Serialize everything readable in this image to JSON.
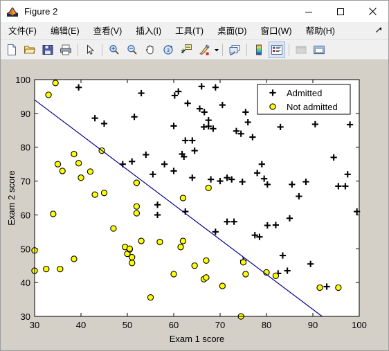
{
  "window": {
    "title": "Figure 2",
    "icon": "matlab-membrane-icon",
    "controls": {
      "minimize": "minimize-icon",
      "maximize": "maximize-icon",
      "close": "close-icon"
    }
  },
  "menubar": {
    "items": [
      {
        "name": "file",
        "text": "文件(F)",
        "label": "文件",
        "accel": "F"
      },
      {
        "name": "edit",
        "text": "编辑(E)",
        "label": "编辑",
        "accel": "E"
      },
      {
        "name": "view",
        "text": "查看(V)",
        "label": "查看",
        "accel": "V"
      },
      {
        "name": "insert",
        "text": "插入(I)",
        "label": "插入",
        "accel": "I"
      },
      {
        "name": "tools",
        "text": "工具(T)",
        "label": "工具",
        "accel": "T"
      },
      {
        "name": "desktop",
        "text": "桌面(D)",
        "label": "桌面",
        "accel": "D"
      },
      {
        "name": "window",
        "text": "窗口(W)",
        "label": "窗口",
        "accel": "W"
      },
      {
        "name": "help",
        "text": "帮助(H)",
        "label": "帮助",
        "accel": "H"
      }
    ],
    "dock_control": "undock-arrow-icon"
  },
  "toolbar": {
    "buttons": [
      {
        "name": "new-figure-button",
        "icon": "new-document-icon",
        "state": "enabled"
      },
      {
        "name": "open-file-button",
        "icon": "open-folder-icon",
        "state": "enabled"
      },
      {
        "name": "save-figure-button",
        "icon": "save-disk-icon",
        "state": "enabled"
      },
      {
        "name": "print-figure-button",
        "icon": "printer-icon",
        "state": "enabled"
      },
      {
        "name": "separator",
        "icon": "separator",
        "state": "n/a"
      },
      {
        "name": "edit-plot-button",
        "icon": "cursor-arrow-icon",
        "state": "enabled"
      },
      {
        "name": "separator",
        "icon": "separator",
        "state": "n/a"
      },
      {
        "name": "zoom-in-button",
        "icon": "zoom-in-icon",
        "state": "enabled"
      },
      {
        "name": "zoom-out-button",
        "icon": "zoom-out-icon",
        "state": "enabled"
      },
      {
        "name": "pan-button",
        "icon": "hand-pan-icon",
        "state": "enabled"
      },
      {
        "name": "rotate-3d-button",
        "icon": "rotate-3d-icon",
        "state": "enabled"
      },
      {
        "name": "data-cursor-button",
        "icon": "data-cursor-icon",
        "state": "enabled"
      },
      {
        "name": "brush-button",
        "icon": "brush-icon",
        "state": "enabled"
      },
      {
        "name": "brush-dropdown",
        "icon": "caret-down-icon",
        "state": "enabled"
      },
      {
        "name": "separator",
        "icon": "separator",
        "state": "n/a"
      },
      {
        "name": "link-plot-button",
        "icon": "link-plot-icon",
        "state": "enabled"
      },
      {
        "name": "separator",
        "icon": "separator",
        "state": "n/a"
      },
      {
        "name": "colorbar-button",
        "icon": "colorbar-icon",
        "state": "enabled"
      },
      {
        "name": "legend-button",
        "icon": "legend-icon",
        "state": "active"
      },
      {
        "name": "separator",
        "icon": "separator",
        "state": "n/a"
      },
      {
        "name": "hide-plot-tools-button",
        "icon": "hide-plot-tools-icon",
        "state": "disabled"
      },
      {
        "name": "show-plot-tools-button",
        "icon": "show-plot-tools-icon",
        "state": "enabled"
      }
    ]
  },
  "chart_data": {
    "type": "scatter",
    "title": "",
    "xlabel": "Exam 1 score",
    "ylabel": "Exam 2 score",
    "xlim": [
      30,
      100
    ],
    "ylim": [
      30,
      100
    ],
    "xticks": [
      30,
      40,
      50,
      60,
      70,
      80,
      90,
      100
    ],
    "yticks": [
      30,
      40,
      50,
      60,
      70,
      80,
      90,
      100
    ],
    "grid": false,
    "background": "#ffffff",
    "legend": {
      "position": "top-right",
      "entries": [
        {
          "label": "Admitted",
          "marker": "plus",
          "color": "#000000",
          "edge": "#000000"
        },
        {
          "label": "Not admitted",
          "marker": "circle",
          "color": "#ffff00",
          "edge": "#000000"
        }
      ]
    },
    "series": [
      {
        "name": "Admitted",
        "marker": "plus",
        "color": "#000000",
        "points": [
          [
            39.5,
            97.7
          ],
          [
            45.0,
            87.0
          ],
          [
            43.0,
            88.6
          ],
          [
            51.5,
            89.0
          ],
          [
            52.0,
            69.4
          ],
          [
            53.0,
            96.0
          ],
          [
            54.0,
            77.8
          ],
          [
            55.5,
            72.0
          ],
          [
            56.5,
            63.0
          ],
          [
            56.5,
            60.0
          ],
          [
            60.0,
            86.3
          ],
          [
            60.2,
            95.3
          ],
          [
            62.2,
            77.2
          ],
          [
            63.0,
            93.0
          ],
          [
            61.8,
            78.0
          ],
          [
            64.0,
            71.0
          ],
          [
            65.6,
            91.4
          ],
          [
            66.6,
            90.4
          ],
          [
            67.5,
            88.0
          ],
          [
            66.0,
            98.0
          ],
          [
            66.5,
            86.0
          ],
          [
            67.5,
            86.2
          ],
          [
            68.5,
            85.5
          ],
          [
            62.5,
            61.0
          ],
          [
            68.0,
            70.5
          ],
          [
            69.0,
            97.7
          ],
          [
            70.5,
            92.5
          ],
          [
            70.0,
            70.0
          ],
          [
            71.5,
            71.0
          ],
          [
            72.5,
            70.5
          ],
          [
            73.5,
            84.8
          ],
          [
            74.5,
            84.0
          ],
          [
            74.8,
            69.8
          ],
          [
            75.0,
            46.5
          ],
          [
            75.5,
            90.4
          ],
          [
            76.0,
            87.4
          ],
          [
            77.0,
            83.0
          ],
          [
            78.0,
            72.4
          ],
          [
            79.0,
            75.0
          ],
          [
            79.5,
            70.7
          ],
          [
            80.0,
            92.2
          ],
          [
            80.2,
            69.0
          ],
          [
            80.2,
            56.9
          ],
          [
            82.0,
            57.0
          ],
          [
            82.5,
            42.7
          ],
          [
            83.0,
            86.0
          ],
          [
            83.5,
            48.0
          ],
          [
            84.5,
            43.5
          ],
          [
            85.0,
            59.0
          ],
          [
            85.5,
            69.0
          ],
          [
            87.0,
            65.5
          ],
          [
            88.5,
            69.8
          ],
          [
            89.5,
            45.5
          ],
          [
            90.0,
            92.0
          ],
          [
            90.5,
            86.8
          ],
          [
            93.0,
            38.8
          ],
          [
            94.5,
            77.0
          ],
          [
            95.5,
            68.5
          ],
          [
            97.0,
            68.5
          ],
          [
            97.5,
            72.0
          ],
          [
            98.0,
            86.7
          ],
          [
            99.5,
            61.0
          ],
          [
            49.0,
            75.0
          ],
          [
            51.0,
            75.8
          ],
          [
            58.0,
            75.0
          ],
          [
            60.0,
            73.0
          ],
          [
            61.0,
            96.5
          ],
          [
            62.5,
            82.0
          ],
          [
            64.0,
            82.0
          ],
          [
            64.5,
            79.0
          ],
          [
            69.0,
            55.0
          ],
          [
            71.5,
            58.0
          ],
          [
            73.0,
            58.0
          ],
          [
            77.5,
            54.0
          ],
          [
            78.5,
            53.5
          ]
        ]
      },
      {
        "name": "Not admitted",
        "marker": "circle",
        "color": "#ffff00",
        "edge": "#000000",
        "points": [
          [
            30.0,
            49.5
          ],
          [
            30.0,
            43.5
          ],
          [
            32.5,
            44.0
          ],
          [
            33.0,
            95.5
          ],
          [
            34.5,
            99.0
          ],
          [
            34.0,
            60.3
          ],
          [
            35.0,
            75.0
          ],
          [
            35.5,
            44.0
          ],
          [
            36.0,
            73.0
          ],
          [
            38.5,
            47.0
          ],
          [
            38.5,
            78.0
          ],
          [
            39.5,
            75.3
          ],
          [
            40.0,
            71.0
          ],
          [
            42.0,
            72.8
          ],
          [
            44.5,
            79.0
          ],
          [
            45.0,
            66.5
          ],
          [
            47.0,
            56.0
          ],
          [
            49.5,
            50.5
          ],
          [
            50.0,
            48.5
          ],
          [
            50.5,
            49.8
          ],
          [
            51.0,
            45.8
          ],
          [
            52.0,
            62.5
          ],
          [
            52.0,
            60.5
          ],
          [
            53.0,
            52.3
          ],
          [
            55.0,
            35.6
          ],
          [
            57.0,
            52.0
          ],
          [
            60.0,
            42.5
          ],
          [
            61.5,
            50.5
          ],
          [
            62.0,
            52.3
          ],
          [
            62.0,
            65.0
          ],
          [
            64.5,
            45.0
          ],
          [
            66.5,
            41.0
          ],
          [
            67.0,
            46.5
          ],
          [
            67.0,
            41.5
          ],
          [
            67.5,
            68.0
          ],
          [
            70.5,
            39.0
          ],
          [
            74.5,
            30.0
          ],
          [
            75.0,
            46.0
          ],
          [
            75.5,
            42.5
          ],
          [
            80.0,
            43.0
          ],
          [
            82.0,
            42.0
          ],
          [
            91.5,
            38.5
          ],
          [
            95.5,
            38.5
          ],
          [
            52.0,
            69.5
          ],
          [
            50.5,
            50.0
          ],
          [
            51.0,
            47.5
          ],
          [
            43.0,
            66.0
          ]
        ]
      }
    ],
    "decision_boundary": {
      "name": "Decision Boundary",
      "color": "#00008b",
      "x": [
        30.0,
        92.0
      ],
      "y": [
        94.0,
        30.0
      ]
    }
  }
}
